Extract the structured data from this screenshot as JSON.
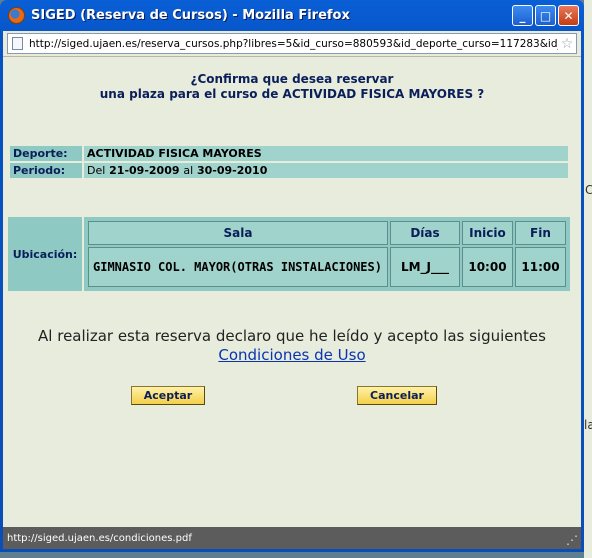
{
  "window": {
    "title": "SIGED (Reserva de Cursos) - Mozilla Firefox",
    "minimize_glyph": "_",
    "maximize_glyph": "□",
    "close_glyph": "✕"
  },
  "address_bar": {
    "url": "http://siged.ujaen.es/reserva_cursos.php?libres=5&id_curso=880593&id_deporte_curso=117283&id_usu"
  },
  "dialog": {
    "question_line1": "¿Confirma que desea reservar",
    "question_line2": "una plaza para el curso de ACTIVIDAD FISICA MAYORES ?",
    "deporte_label": "Deporte:",
    "deporte_value": "ACTIVIDAD FISICA MAYORES",
    "periodo_label": "Periodo:",
    "periodo_prefix": "Del",
    "periodo_start": "21-09-2009",
    "periodo_mid": "al",
    "periodo_end": "30-09-2010",
    "ubicacion_label": "Ubicación:",
    "table": {
      "headers": [
        "Sala",
        "Días",
        "Inicio",
        "Fin"
      ],
      "row": [
        "GIMNASIO COL. MAYOR(OTRAS INSTALACIONES)",
        "LM_J___",
        "10:00",
        "11:00"
      ]
    },
    "declaration": "Al realizar esta reserva declaro que he leído y acepto las siguientes",
    "conditions_link": "Condiciones de Uso",
    "accept_label": "Aceptar",
    "cancel_label": "Cancelar"
  },
  "status_bar": {
    "text": "http://siged.ujaen.es/condiciones.pdf"
  },
  "background_page": {
    "fragments": [
      "C",
      "la"
    ]
  },
  "colors": {
    "titlebar": "#0553c4",
    "content_bg": "#e8ecdc",
    "label_cell": "#8ec9c4",
    "value_cell": "#9fd3cc",
    "button": "#f3cf4a",
    "link": "#0a34b0"
  }
}
